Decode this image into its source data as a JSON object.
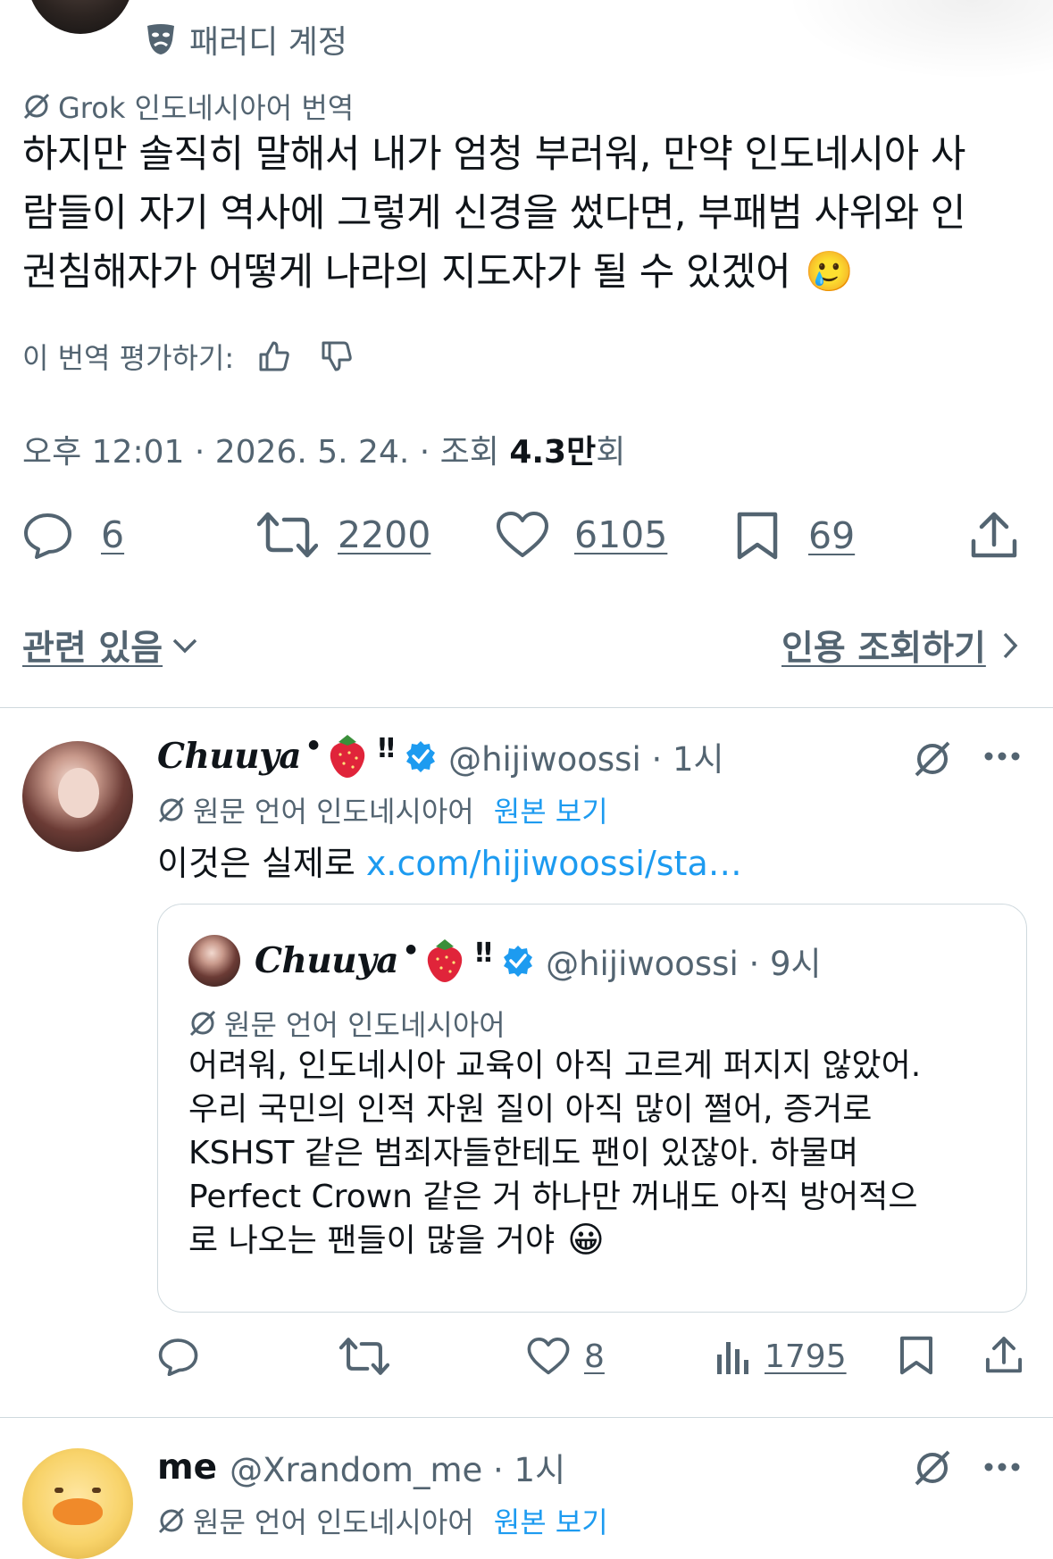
{
  "header": {
    "account_label": "패러디 계정",
    "name_partial": ""
  },
  "tweet": {
    "translation_label": "Grok 인도네시아어 번역",
    "lines": [
      "하지만 솔직히 말해서 내가 엄청 부러워, 만약 인도네시아 사",
      "람들이 자기 역사에 그렇게 신경을 썼다면, 부패범 사위와 인",
      "권침해자가 어떻게 나라의 지도자가 될 수 있겠어"
    ],
    "emoji": "🥲",
    "rate_label": "이 번역 평가하기:",
    "time": "오후 12:01 · 2026. 5. 24. · 조회 ",
    "views_bold": "4.3만",
    "views_suffix": "회",
    "counts": {
      "replies": "6",
      "retweets": "2200",
      "likes": "6105",
      "bookmarks": "69"
    },
    "related_label": "관련 있음",
    "quotes_label": "인용 조회하기"
  },
  "reply1": {
    "name": "Chuuya",
    "suffix": "‼",
    "handle": "@hijiwoossi · 1시",
    "lang_label": "원문 언어 인도네시아어",
    "view_original": "원본 보기",
    "text_prefix": "이것은 실제로 ",
    "link": "x.com/hijiwoossi/sta…",
    "quote": {
      "name": "Chuuya",
      "suffix": "‼",
      "handle": "@hijiwoossi · 9시",
      "lang_label": "원문 언어 인도네시아어",
      "lines": [
        "어려워, 인도네시아 교육이 아직 고르게 퍼지지 않았어.",
        "우리 국민의 인적 자원 질이 아직 많이 쩔어, 증거로",
        "KSHST 같은 범죄자들한테도 팬이 있잖아. 하물며",
        "Perfect Crown 같은 거 하나만 꺼내도 아직 방어적으",
        "로 나오는 팬들이 많을 거야"
      ],
      "emoji": "😀"
    },
    "counts": {
      "likes": "8",
      "views": "1795"
    }
  },
  "reply2": {
    "name": "me",
    "handle": "@Xrandom_me · 1시",
    "lang_label": "원문 언어 인도네시아어",
    "view_original": "원본 보기"
  },
  "colors": {
    "accent": "#1d9bf0",
    "muted": "#536471",
    "divider": "#cfd9de",
    "text": "#0f1419"
  },
  "icons": [
    "theater-mask-icon",
    "translate-icon",
    "thumbs-up-icon",
    "thumbs-down-icon",
    "reply-icon",
    "retweet-icon",
    "like-icon",
    "bookmark-icon",
    "share-icon",
    "chevron-down-icon",
    "chevron-right-icon",
    "verified-badge-icon",
    "grok-icon",
    "more-icon",
    "views-icon",
    "strawberry-icon"
  ]
}
